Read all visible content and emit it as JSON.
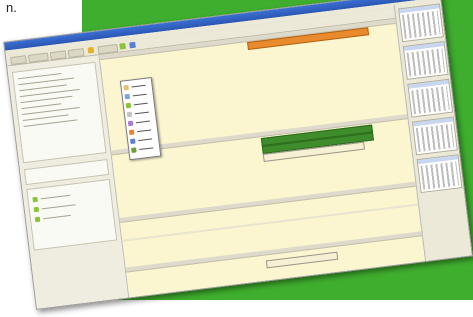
{
  "caption": "n.",
  "colors": {
    "background_green": "#3fae2e",
    "calendar_bg": "#fbf6cf",
    "event_orange": "#e98a2c",
    "event_green": "#3f8c2d"
  },
  "icons": [
    "window-minimize-icon",
    "window-maximize-icon",
    "window-close-icon",
    "calendar-icon",
    "event-icon",
    "task-icon"
  ]
}
